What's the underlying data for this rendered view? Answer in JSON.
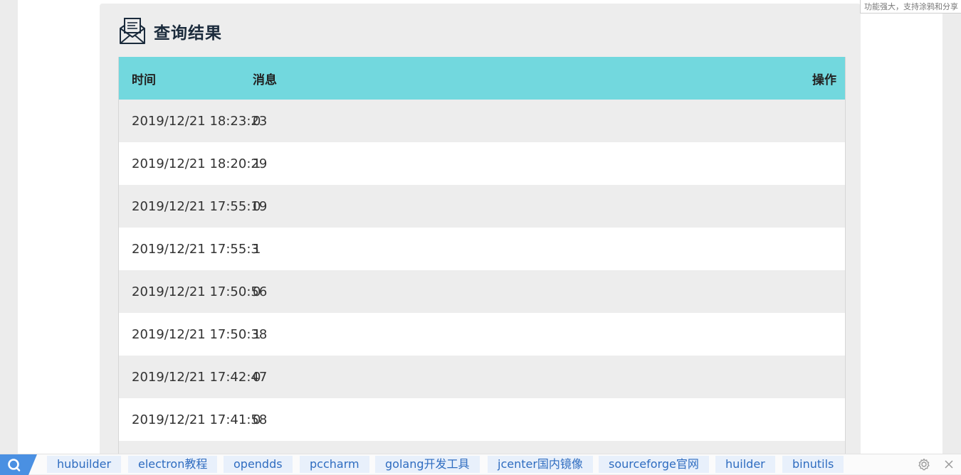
{
  "panel": {
    "title": "查询结果",
    "icon": "envelope-icon"
  },
  "table": {
    "headers": {
      "time": "时间",
      "message": "消息",
      "action": "操作"
    },
    "rows": [
      {
        "time": "2019/12/21 18:23:23",
        "message": "0"
      },
      {
        "time": "2019/12/21 18:20:29",
        "message": "1"
      },
      {
        "time": "2019/12/21 17:55:19",
        "message": "0"
      },
      {
        "time": "2019/12/21 17:55:3",
        "message": "1"
      },
      {
        "time": "2019/12/21 17:50:56",
        "message": "0"
      },
      {
        "time": "2019/12/21 17:50:38",
        "message": "1"
      },
      {
        "time": "2019/12/21 17:42:47",
        "message": "0"
      },
      {
        "time": "2019/12/21 17:41:58",
        "message": "0"
      }
    ]
  },
  "tooltip": {
    "text": "功能强大，支持涂鸦和分享"
  },
  "bookmarks": [
    "hubuilder",
    "electron教程",
    "opendds",
    "pccharm",
    "golang开发工具",
    "jcenter国内镜像",
    "sourceforge官网",
    "huilder",
    "binutils"
  ],
  "colors": {
    "header_bg": "#72d8de",
    "bookmark_text": "#2e6cc0",
    "search_tab": "#4a90e2"
  }
}
